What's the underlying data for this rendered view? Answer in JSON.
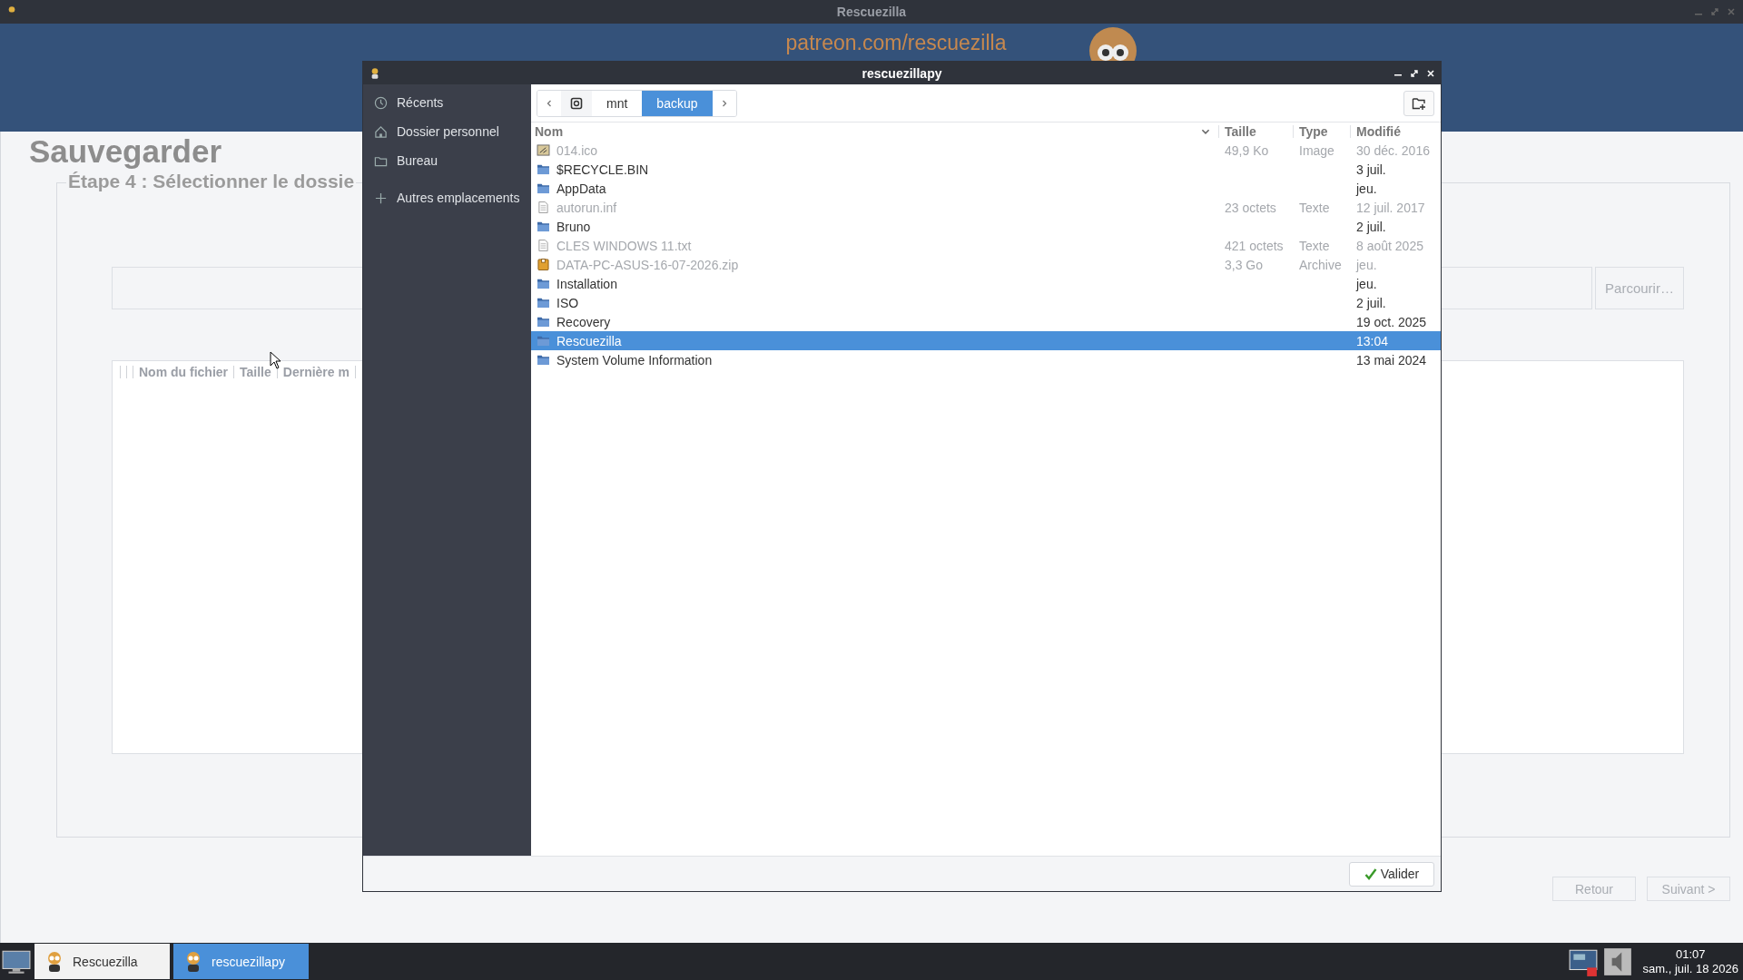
{
  "window": {
    "title": "Rescuezilla"
  },
  "banner": {
    "link": "patreon.com/rescuezilla"
  },
  "page": {
    "title": "Sauvegarder",
    "step": "Étape 4 : Sélectionner le dossie",
    "browse_button": {
      "label": "Parcourir…",
      "disabled": true
    },
    "table_columns": [
      "Nom du fichier",
      "Taille",
      "Dernière m"
    ],
    "buttons": [
      {
        "label": "Retour",
        "disabled": true
      },
      {
        "label": "Suivant >",
        "disabled": true
      }
    ]
  },
  "dialog": {
    "title": "rescuezillapy",
    "places": [
      {
        "label": "Récents",
        "kind": "recent"
      },
      {
        "label": "Dossier personnel",
        "kind": "home"
      },
      {
        "label": "Bureau",
        "kind": "folder"
      },
      {
        "label": "Autres emplacements",
        "kind": "other"
      }
    ],
    "path": [
      {
        "label": "mnt",
        "selected": false
      },
      {
        "label": "backup",
        "selected": true
      }
    ],
    "columns": [
      "Nom",
      "Taille",
      "Type",
      "Modifié"
    ],
    "files": [
      {
        "name": "014.ico",
        "size": "49,9 Ko",
        "type": "Image",
        "modified": "30 déc. 2016",
        "kind": "image",
        "disabled": true,
        "selected": false
      },
      {
        "name": "$RECYCLE.BIN",
        "modified": "3 juil.",
        "kind": "folder",
        "disabled": false,
        "selected": false
      },
      {
        "name": "AppData",
        "modified": "jeu.",
        "kind": "folder",
        "disabled": false,
        "selected": false
      },
      {
        "name": "autorun.inf",
        "size": "23 octets",
        "type": "Texte",
        "modified": "12 juil. 2017",
        "kind": "text",
        "disabled": true,
        "selected": false
      },
      {
        "name": "Bruno",
        "modified": "2 juil.",
        "kind": "folder",
        "disabled": false,
        "selected": false
      },
      {
        "name": "CLES WINDOWS 11.txt",
        "size": "421 octets",
        "type": "Texte",
        "modified": "8 août 2025",
        "kind": "text",
        "disabled": true,
        "selected": false
      },
      {
        "name": "DATA-PC-ASUS-16-07-2026.zip",
        "size": "3,3 Go",
        "type": "Archive",
        "modified": "jeu.",
        "kind": "archive",
        "disabled": true,
        "selected": false
      },
      {
        "name": "Installation",
        "modified": "jeu.",
        "kind": "folder",
        "disabled": false,
        "selected": false
      },
      {
        "name": "ISO",
        "modified": "2 juil.",
        "kind": "folder",
        "disabled": false,
        "selected": false
      },
      {
        "name": "Recovery",
        "modified": "19 oct. 2025",
        "kind": "folder",
        "disabled": false,
        "selected": false
      },
      {
        "name": "Rescuezilla",
        "modified": "13:04",
        "kind": "folder",
        "disabled": false,
        "selected": true
      },
      {
        "name": "System Volume Information",
        "modified": "13 mai 2024",
        "kind": "folder",
        "disabled": false,
        "selected": false
      }
    ],
    "confirm_button": "Valider"
  },
  "taskbar": {
    "tasks": [
      {
        "label": "Rescuezilla",
        "selected": false
      },
      {
        "label": "rescuezillapy",
        "selected": true
      }
    ],
    "time": "01:07",
    "date": "sam., juil. 18 2026"
  }
}
